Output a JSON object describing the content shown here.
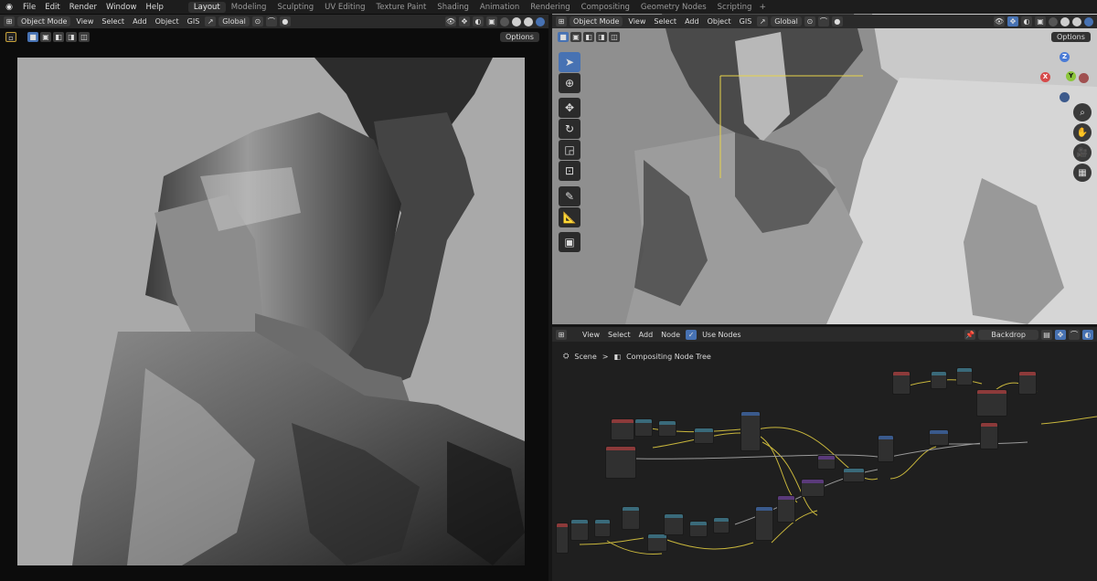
{
  "topbar": {
    "menus": [
      "File",
      "Edit",
      "Render",
      "Window",
      "Help"
    ],
    "workspaces": [
      "Layout",
      "Modeling",
      "Sculpting",
      "UV Editing",
      "Texture Paint",
      "Shading",
      "Animation",
      "Rendering",
      "Compositing",
      "Geometry Nodes",
      "Scripting"
    ],
    "active_workspace": "Layout",
    "add_workspace": "+"
  },
  "left_viewport": {
    "mode": "Object Mode",
    "menus": [
      "View",
      "Select",
      "Add",
      "Object",
      "GIS"
    ],
    "orientation": "Global",
    "options": "Options"
  },
  "right_viewport": {
    "mode": "Object Mode",
    "menus": [
      "View",
      "Select",
      "Add",
      "Object",
      "GIS"
    ],
    "orientation": "Global",
    "options": "Options",
    "gizmo_axes": {
      "z": "Z",
      "y": "Y",
      "x": "X"
    }
  },
  "node_editor": {
    "menus": [
      "View",
      "Select",
      "Add",
      "Node"
    ],
    "use_nodes_label": "Use Nodes",
    "use_nodes_checked": true,
    "backdrop": "Backdrop",
    "breadcrumb": {
      "scene": "Scene",
      "separator": ">",
      "tree": "Compositing Node Tree"
    }
  },
  "colors": {
    "accent": "#4772b3",
    "wire": "#c8b63c",
    "header": "#2a2a2a",
    "viewport_bg": "#a8a8a8"
  }
}
